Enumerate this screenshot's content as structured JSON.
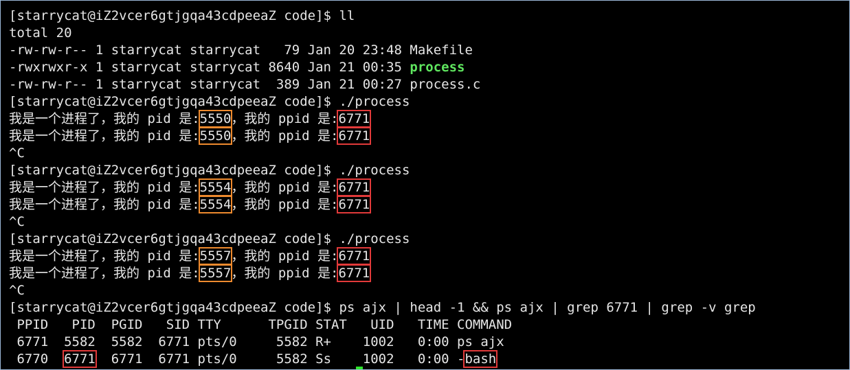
{
  "terminal": {
    "prompt": "[starrycat@iZ2vcer6gtjgqa43cdpeeaZ code]$ ",
    "cmd_ll": "ll",
    "total": "total 20",
    "ls": [
      {
        "meta": "-rw-rw-r-- 1 starrycat starrycat   79 Jan 20 23:48 ",
        "name": "Makefile"
      },
      {
        "meta": "-rwxrwxr-x 1 starrycat starrycat 8640 Jan 21 00:35 ",
        "name": "process"
      },
      {
        "meta": "-rw-rw-r-- 1 starrycat starrycat  389 Jan 21 00:27 ",
        "name": "process.c"
      }
    ],
    "cmd_run": "./process",
    "out_prefix": "我是一个进程了，我的 pid 是:",
    "out_mid": "，我的 ppid 是:",
    "runs": [
      {
        "pid": "5550",
        "ppid": "6771"
      },
      {
        "pid": "5554",
        "ppid": "6771"
      },
      {
        "pid": "5557",
        "ppid": "6771"
      }
    ],
    "ctrl_c": "^C",
    "cmd_ps": "ps ajx | head -1 && ps ajx | grep 6771 | grep -v grep",
    "ps_header": " PPID   PID  PGID   SID TTY      TPGID STAT   UID   TIME COMMAND",
    "ps_row1": " 6771  5582  5582  6771 pts/0     5582 R+    1002   0:00 ps ajx",
    "ps_row2": {
      "ppid": " 6770  ",
      "pid": "6771",
      "rest": "  6771  6771 pts/0     5582 Ss    1002   0:00 -",
      "command": "bash"
    }
  },
  "colors": {
    "background": "#000000",
    "text": "#e6e6e6",
    "executable": "#5fe65f",
    "highlight_pid": "#ee8a2e",
    "highlight_ppid": "#e23a3a",
    "cursor": "#2ee62e"
  }
}
